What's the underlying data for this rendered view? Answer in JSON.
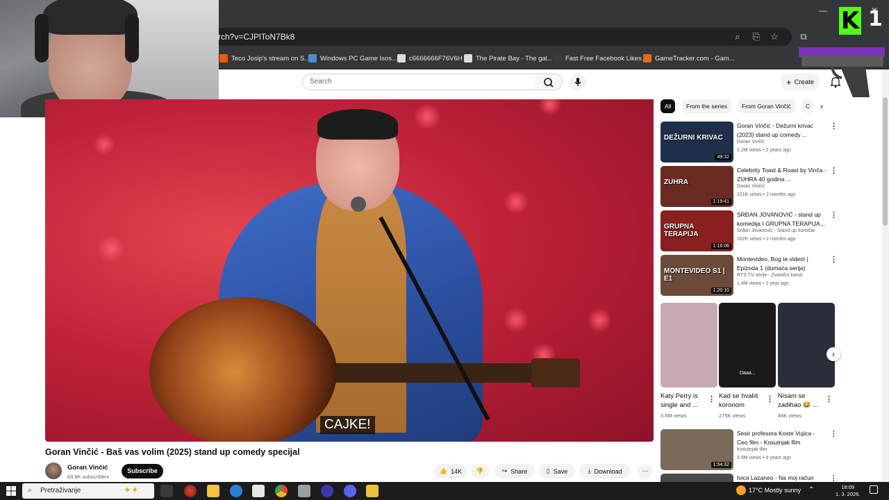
{
  "browser": {
    "url": "rch?v=CJPlToN7Bk8",
    "bookmarks": [
      {
        "label": "Teco Josip's stream on S...",
        "color": "#ff5500"
      },
      {
        "label": "Windows PC Game Isos...",
        "color": "#4a8cd6"
      },
      {
        "label": "c6666666F76V6H",
        "color": "#ddd"
      },
      {
        "label": "The Pirate Bay - The gal...",
        "color": "#ddd"
      },
      {
        "label": "Fast Free Facebook Likes...",
        "color": "#3b3b3b"
      },
      {
        "label": "GameTracker.com - Gam...",
        "color": "#e56a1a"
      }
    ]
  },
  "overlay": {
    "kick_letter": "K",
    "kick_number": "1"
  },
  "header": {
    "search_placeholder": "Search",
    "create_label": "Create"
  },
  "player": {
    "subtitle": "CAJKE!"
  },
  "video": {
    "title": "Goran Vinčić - Baš vas volim (2025) stand up comedy specijal",
    "channel": "Goran Vinčić",
    "subscribers": "63.8K subscribers",
    "subscribe_label": "Subscribe",
    "likes": "14K",
    "share_label": "Share",
    "save_label": "Save",
    "download_label": "Download"
  },
  "chips": [
    "All",
    "From the series",
    "From Goran Vinčić",
    "C"
  ],
  "recommended": [
    {
      "title": "Goran Vinčić - Dežurni krivac (2023) stand up comedy ...",
      "channel": "Goran Vinčić",
      "meta": "2.2M views • 2 years ago",
      "duration": "49:32",
      "thumb_text": "DEŽURNI KRIVAC",
      "thumb_color": "#1d2f4a"
    },
    {
      "title": "Celebrity Toast & Roast by Vinča - ZUHRA 40 godina ...",
      "channel": "Goran Vinčić",
      "meta": "101K views • 2 months ago",
      "duration": "1:19:41",
      "thumb_text": "ZUHRA",
      "thumb_color": "#6a2a22"
    },
    {
      "title": "SRĐAN JOVANOVIĆ - stand up komedija I GRUPNA TERAPIJA...",
      "channel": "Srđan Jovanović - Stand up komičar",
      "meta": "162K views • 2 months ago",
      "duration": "1:16:06",
      "thumb_text": "GRUPNA TERAPIJA",
      "thumb_color": "#8a1f1f"
    },
    {
      "title": "Montevideo, Bog te video! | Epizoda 1 (domaća serija)",
      "channel": "RTS TV serije - Zvanični kanal",
      "meta": "1.4M views • 1 year ago",
      "duration": "1:20:10",
      "thumb_text": "MONTEVIDEO S1 | E1",
      "thumb_color": "#6b4a3a"
    }
  ],
  "shorts": [
    {
      "title": "Katy Perry is single and ...",
      "views": "3.6M views",
      "color": "#c7a8b4"
    },
    {
      "title": "Kad se hvališ koronom",
      "views": "275K views",
      "color": "#1a1a1a"
    },
    {
      "title": "Nisam se zadihao 😂 ...",
      "views": "49K views",
      "color": "#2a2d3a"
    }
  ],
  "more_recommended": [
    {
      "title": "Sesir profesora Koste Vujica - Ceo film - Kosutnjak film",
      "channel": "Kosutnjak film",
      "meta": "3.9M views • 4 years ago",
      "duration": "1:54:32",
      "thumb_color": "#7a6a5a"
    },
    {
      "title": "Ivica Lazaneo - Na moj račun",
      "channel": "",
      "meta": "",
      "duration": "",
      "thumb_color": "#4a4a4a"
    }
  ],
  "shorts_extra_label": "Daaa...",
  "taskbar": {
    "search_text": "Pretraživanje",
    "weather": "17°C  Mostly sunny",
    "time": "18:09",
    "date": "1. 3. 2026."
  }
}
